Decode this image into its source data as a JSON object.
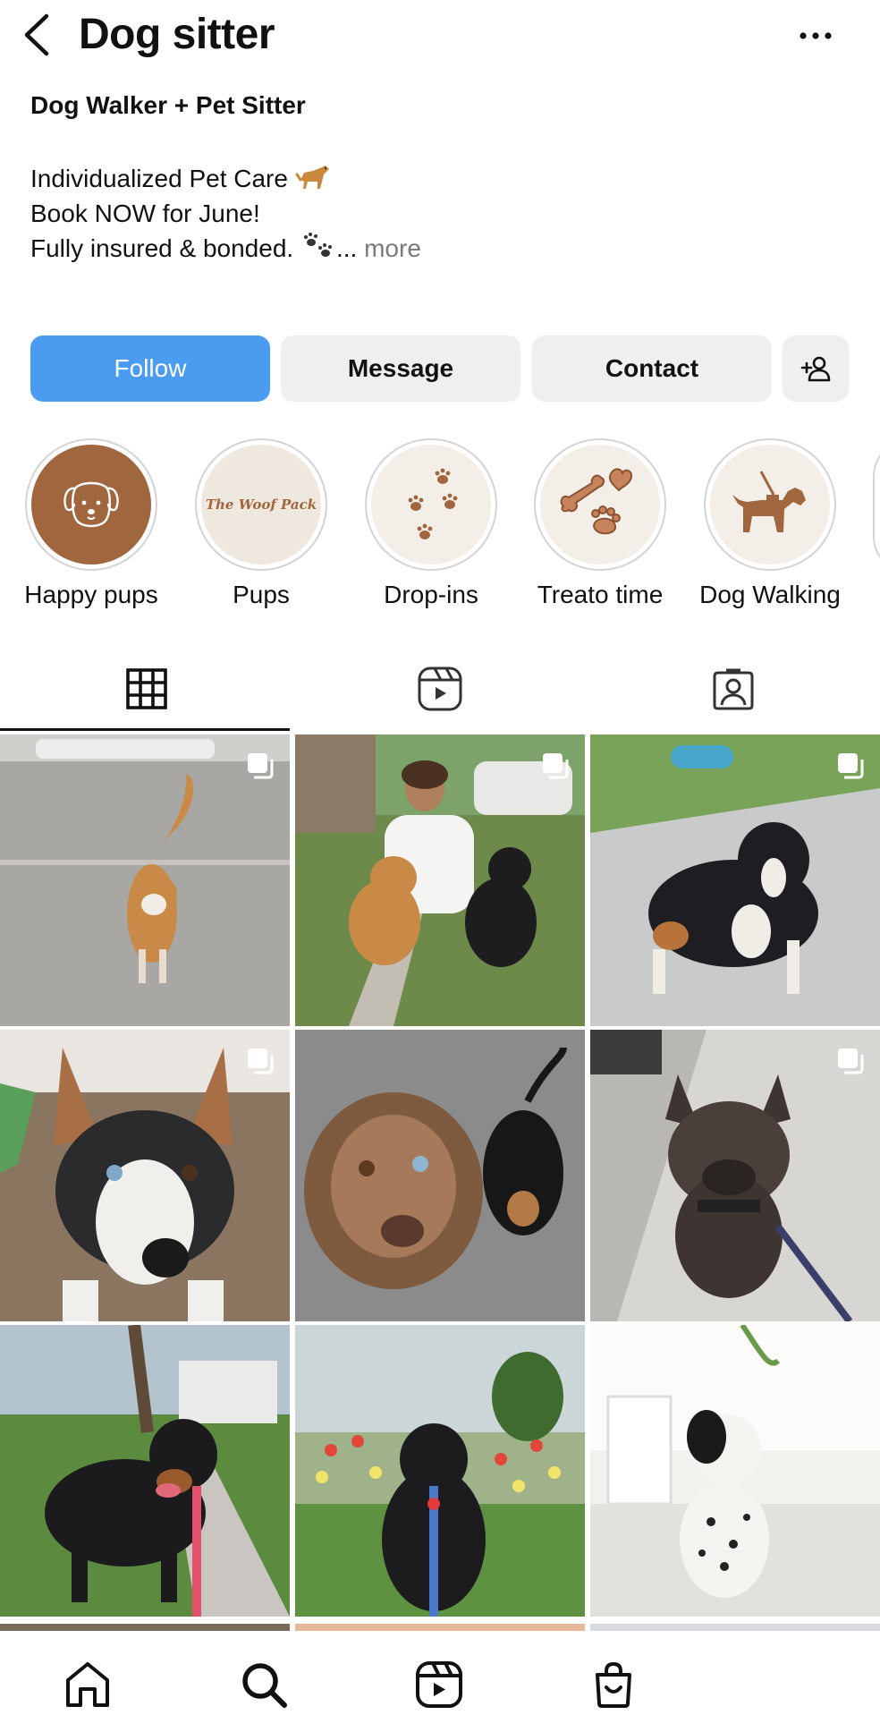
{
  "header": {
    "title": "Dog sitter"
  },
  "bio": {
    "category": "Dog Walker + Pet Sitter",
    "line1": "Individualized Pet Care",
    "line2": "Book NOW for June!",
    "line3": "Fully insured & bonded.",
    "more_prefix": "...",
    "more_label": "more"
  },
  "actions": {
    "follow_label": "Follow",
    "message_label": "Message",
    "contact_label": "Contact"
  },
  "highlights": [
    {
      "label": "Happy pups",
      "icon": "dog-face-icon"
    },
    {
      "label": "Pups",
      "text": "The Woof Pack",
      "icon": "woof-pack-logo"
    },
    {
      "label": "Drop-ins",
      "icon": "paw-prints-icon"
    },
    {
      "label": "Treato time",
      "icon": "bone-treats-icon"
    },
    {
      "label": "Dog Walking",
      "icon": "dog-walking-icon"
    }
  ],
  "tabs": [
    "grid-icon",
    "reels-icon",
    "tagged-icon"
  ],
  "posts": [
    {
      "subject": "dog-on-gravel",
      "multi": true
    },
    {
      "subject": "woman-with-two-dogs",
      "multi": true
    },
    {
      "subject": "tricolor-dog-with-toy",
      "multi": true
    },
    {
      "subject": "corgi-closeup",
      "multi": true
    },
    {
      "subject": "two-dogs-looking-up",
      "multi": false
    },
    {
      "subject": "french-bulldog",
      "multi": true
    },
    {
      "subject": "rottweiler",
      "multi": false
    },
    {
      "subject": "black-lab-with-flowers",
      "multi": false
    },
    {
      "subject": "dalmatian-mix",
      "multi": false
    }
  ],
  "bottom_nav": [
    "home-icon",
    "search-icon",
    "reels-icon",
    "shop-icon"
  ],
  "colors": {
    "follow_blue": "#4a9cf1",
    "button_gray": "#efefef",
    "highlight_brown": "#a0673f"
  }
}
